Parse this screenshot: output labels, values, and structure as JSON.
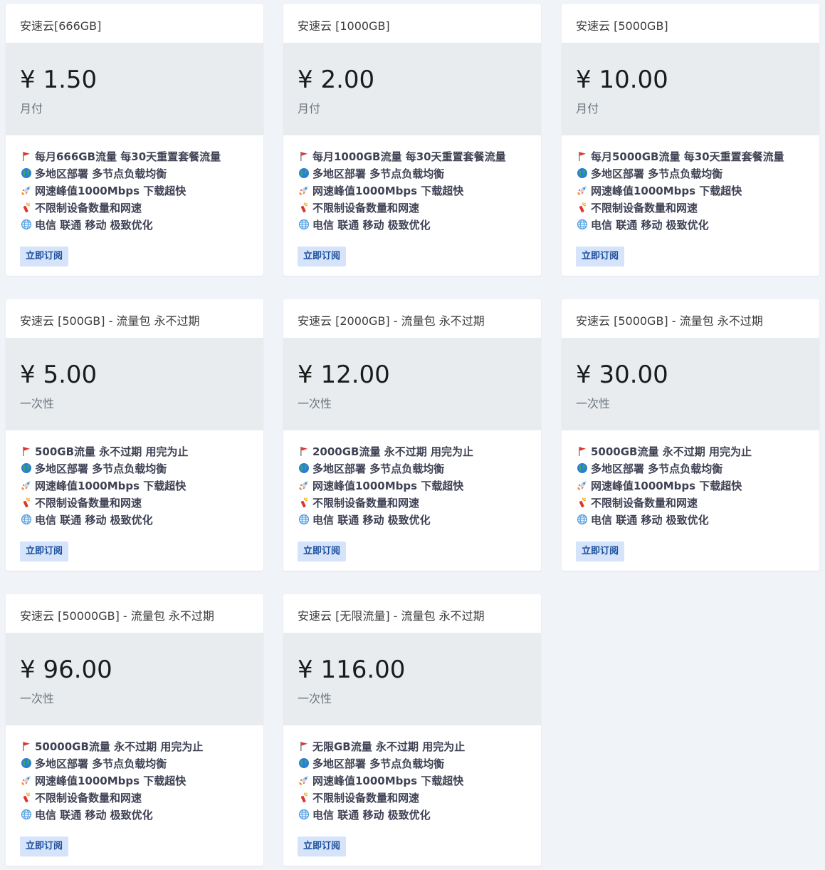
{
  "currency_symbol": "¥",
  "feature_icons": [
    "red-flag-icon",
    "globe-icon",
    "rocket-icon",
    "firecracker-icon",
    "network-globe-icon"
  ],
  "colors": {
    "page_bg": "#f0f3f8",
    "card_bg": "#ffffff",
    "price_bg": "#e9ecef",
    "button_bg": "#d6e4fb",
    "button_text": "#1c4f9c"
  },
  "plans": [
    {
      "title": "安速云[666GB]",
      "price": "¥ 1.50",
      "cycle": "月付",
      "features": [
        "每月666GB流量 每30天重置套餐流量",
        "多地区部署 多节点负载均衡",
        "网速峰值1000Mbps 下载超快",
        "不限制设备数量和网速",
        "电信 联通 移动 极致优化"
      ],
      "button": "立即订阅"
    },
    {
      "title": "安速云 [1000GB]",
      "price": "¥ 2.00",
      "cycle": "月付",
      "features": [
        "每月1000GB流量 每30天重置套餐流量",
        "多地区部署 多节点负载均衡",
        "网速峰值1000Mbps 下载超快",
        "不限制设备数量和网速",
        "电信 联通 移动 极致优化"
      ],
      "button": "立即订阅"
    },
    {
      "title": "安速云 [5000GB]",
      "price": "¥ 10.00",
      "cycle": "月付",
      "features": [
        "每月5000GB流量 每30天重置套餐流量",
        "多地区部署 多节点负载均衡",
        "网速峰值1000Mbps 下载超快",
        "不限制设备数量和网速",
        "电信 联通 移动 极致优化"
      ],
      "button": "立即订阅"
    },
    {
      "title": "安速云 [500GB] - 流量包 永不过期",
      "price": "¥ 5.00",
      "cycle": "一次性",
      "features": [
        "500GB流量 永不过期 用完为止",
        "多地区部署 多节点负载均衡",
        "网速峰值1000Mbps 下载超快",
        "不限制设备数量和网速",
        "电信 联通 移动 极致优化"
      ],
      "button": "立即订阅"
    },
    {
      "title": "安速云 [2000GB] - 流量包 永不过期",
      "price": "¥ 12.00",
      "cycle": "一次性",
      "features": [
        "2000GB流量 永不过期 用完为止",
        "多地区部署 多节点负载均衡",
        "网速峰值1000Mbps 下载超快",
        "不限制设备数量和网速",
        "电信 联通 移动 极致优化"
      ],
      "button": "立即订阅"
    },
    {
      "title": "安速云 [5000GB] - 流量包 永不过期",
      "price": "¥ 30.00",
      "cycle": "一次性",
      "features": [
        "5000GB流量 永不过期 用完为止",
        "多地区部署 多节点负载均衡",
        "网速峰值1000Mbps 下载超快",
        "不限制设备数量和网速",
        "电信 联通 移动 极致优化"
      ],
      "button": "立即订阅"
    },
    {
      "title": "安速云 [50000GB] - 流量包 永不过期",
      "price": "¥ 96.00",
      "cycle": "一次性",
      "features": [
        "50000GB流量 永不过期 用完为止",
        "多地区部署 多节点负载均衡",
        "网速峰值1000Mbps 下载超快",
        "不限制设备数量和网速",
        "电信 联通 移动 极致优化"
      ],
      "button": "立即订阅"
    },
    {
      "title": "安速云 [无限流量] - 流量包 永不过期",
      "price": "¥ 116.00",
      "cycle": "一次性",
      "features": [
        "无限GB流量 永不过期 用完为止",
        "多地区部署 多节点负载均衡",
        "网速峰值1000Mbps 下载超快",
        "不限制设备数量和网速",
        "电信 联通 移动 极致优化"
      ],
      "button": "立即订阅"
    }
  ]
}
